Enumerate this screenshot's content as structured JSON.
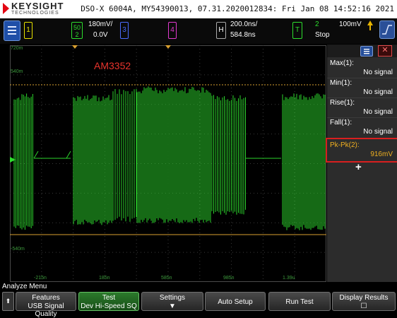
{
  "header": {
    "brand": "KEYSIGHT",
    "brand_sub": "TECHNOLOGIES",
    "device_info": "DSO-X 6004A, MY54390013, 07.31.2020012834: Fri Jan 08 14:52:16 2021"
  },
  "channels": {
    "ch1": {
      "label": "1"
    },
    "ch2": {
      "label": "2",
      "top_text": "50",
      "scale": "180mV/",
      "offset": "0.0V"
    },
    "ch3": {
      "label": "3"
    },
    "ch4": {
      "label": "4"
    }
  },
  "horizontal": {
    "label": "H",
    "time_per_div": "200.0ns/",
    "delay": "584.8ns"
  },
  "trigger": {
    "label": "T",
    "source": "2",
    "level": "100mV",
    "state": "Stop"
  },
  "waveform": {
    "annotation": "AM3352",
    "y_labels": [
      "720m",
      "540m",
      "-540m"
    ],
    "x_labels": [
      "-215n",
      "185n",
      "585n",
      "985n",
      "1.39u"
    ],
    "markers": {
      "ch_marker": "2"
    }
  },
  "measurements": [
    {
      "name": "Max(1):",
      "value": "No signal"
    },
    {
      "name": "Min(1):",
      "value": "No signal"
    },
    {
      "name": "Rise(1):",
      "value": "No signal"
    },
    {
      "name": "Fall(1):",
      "value": "No signal"
    }
  ],
  "highlighted_measurement": {
    "name": "Pk-Pk(2):",
    "value": "916mV"
  },
  "add_symbol": "+",
  "bottom": {
    "menu_label": "Analyze Menu",
    "keys": [
      {
        "l1": "Features",
        "l2": "USB Signal Quality"
      },
      {
        "l1": "Test",
        "l2": "Dev Hi-Speed SQ"
      },
      {
        "l1": "Settings",
        "l2": ""
      },
      {
        "l1": "Auto Setup",
        "l2": ""
      },
      {
        "l1": "Run Test",
        "l2": ""
      },
      {
        "l1": "Display Results",
        "l2": ""
      }
    ]
  },
  "colors": {
    "ch1": "#e7e200",
    "ch2": "#2dde2d",
    "ch3": "#4a6cff",
    "ch4": "#e33ad0",
    "highlight": "#d81f1f",
    "ref_line": "#d9a030"
  }
}
